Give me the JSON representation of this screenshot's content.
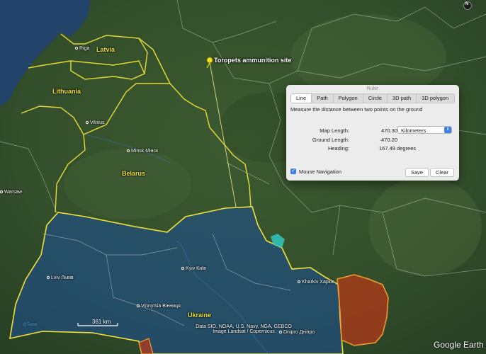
{
  "map": {
    "countries": [
      "Latvia",
      "Lithuania",
      "Belarus",
      "Ukraine"
    ],
    "cities": [
      "Riga",
      "Vilnius",
      "Minsk Мінск",
      "Warsaw",
      "Kyiv Київ",
      "Lviv Львів",
      "Vinnytsia Вінниця",
      "Kharkiv Харків",
      "Dnipro Дніпро"
    ],
    "pin_label": "Toropets ammunition site",
    "credits": [
      "Data SIO, NOAA, U.S. Navy, NGA, GEBCO",
      "Image Landsat / Copernicus"
    ],
    "scale": "361 km",
    "watermark": "Google Earth",
    "handle": "@Tedor",
    "compass": "N",
    "colors": {
      "border": "#f2e23a",
      "ukraine_overlay": "#1f4f8c",
      "occupied_overlay": "#b33a1a",
      "measure_line": "#e8e07a",
      "pin": "#f0e020"
    }
  },
  "ruler": {
    "title": "Ruler",
    "tabs": [
      "Line",
      "Path",
      "Polygon",
      "Circle",
      "3D path",
      "3D polygon"
    ],
    "active_tab": "Line",
    "description": "Measure the distance between two points on the ground",
    "map_length_label": "Map Length:",
    "map_length_value": "470.30",
    "unit": "Kilometers",
    "ground_length_label": "Ground Length:",
    "ground_length_value": "470.20",
    "heading_label": "Heading:",
    "heading_value": "167.49 degrees",
    "mouse_nav_label": "Mouse Navigation",
    "mouse_nav_checked": true,
    "save_label": "Save",
    "clear_label": "Clear"
  }
}
